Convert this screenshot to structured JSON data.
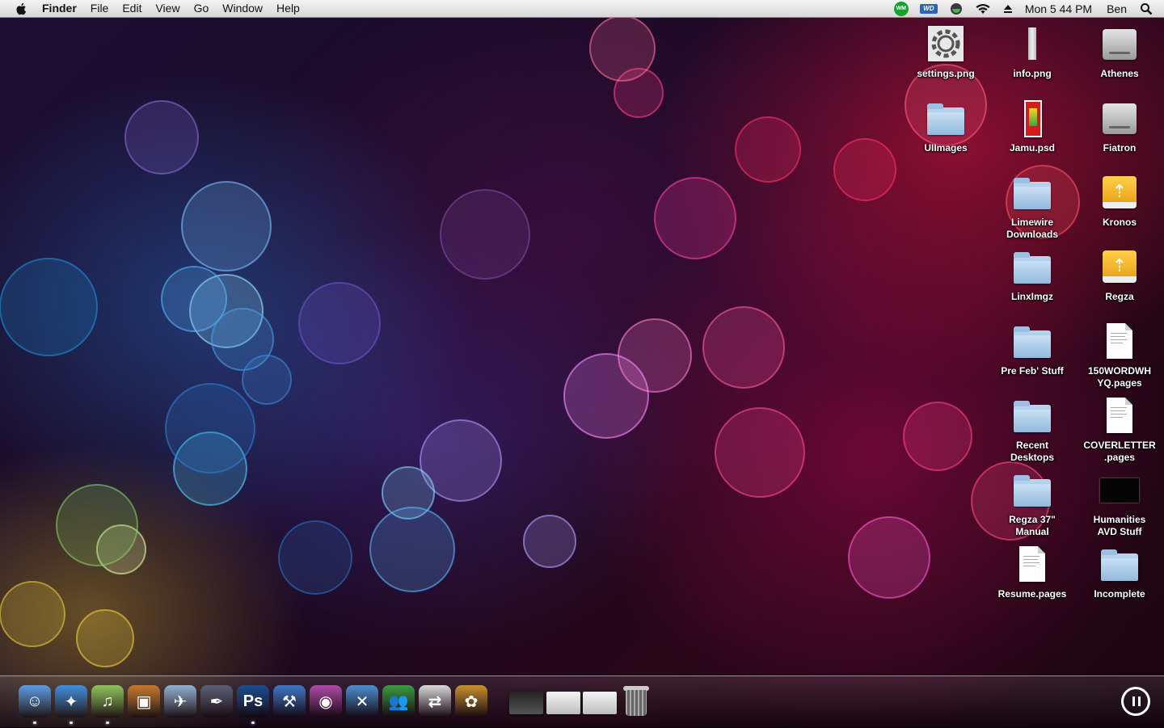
{
  "menubar": {
    "app_name": "Finder",
    "menus": [
      "File",
      "Edit",
      "View",
      "Go",
      "Window",
      "Help"
    ],
    "status_icons": {
      "wm_badge": "WM",
      "wd_badge": "WD"
    },
    "clock": "Mon 5 44 PM",
    "user": "Ben"
  },
  "desktop_icons": [
    {
      "label": "settings.png",
      "icon": "gear-image"
    },
    {
      "label": "info.png",
      "icon": "info-image"
    },
    {
      "label": "Athenes",
      "icon": "hard-drive"
    },
    {
      "label": "UIImages",
      "icon": "folder"
    },
    {
      "label": "Jamu.psd",
      "icon": "psd-file"
    },
    {
      "label": "Fiatron",
      "icon": "hard-drive"
    },
    {
      "label": "Limewire\nDownloads",
      "icon": "folder"
    },
    {
      "label": "Kronos",
      "icon": "usb-drive"
    },
    {
      "label": "LinxImgz",
      "icon": "folder"
    },
    {
      "label": "Regza",
      "icon": "usb-drive"
    },
    {
      "label": "Pre Feb' Stuff",
      "icon": "folder"
    },
    {
      "label": "150WORDWH\nYQ.pages",
      "icon": "document"
    },
    {
      "label": "Recent\nDesktops",
      "icon": "folder"
    },
    {
      "label": "COVERLETTER\n.pages",
      "icon": "document"
    },
    {
      "label": "Regza 37\"\nManual",
      "icon": "folder"
    },
    {
      "label": "Humanities\nAVD Stuff",
      "icon": "black-image"
    },
    {
      "label": "Resume.pages",
      "icon": "document"
    },
    {
      "label": "Incomplete",
      "icon": "folder"
    }
  ],
  "dock": {
    "apps": [
      {
        "name": "Finder",
        "icon": "finder-icon",
        "color": "#5b9be6",
        "glyph": "☺",
        "running": true
      },
      {
        "name": "Safari",
        "icon": "safari-icon",
        "color": "#3f8ee0",
        "glyph": "✦",
        "running": true
      },
      {
        "name": "iTunes",
        "icon": "itunes-icon",
        "color": "#8fc45a",
        "glyph": "♫",
        "running": true
      },
      {
        "name": "iPhoto",
        "icon": "iphoto-icon",
        "color": "#c9772b",
        "glyph": "▣",
        "running": false
      },
      {
        "name": "Preview",
        "icon": "preview-icon",
        "color": "#8fb0d6",
        "glyph": "✈",
        "running": false
      },
      {
        "name": "Pen Tool",
        "icon": "pen-tool-icon",
        "color": "#5a5f78",
        "glyph": "✒",
        "running": false
      },
      {
        "name": "Photoshop",
        "icon": "photoshop-icon",
        "color": "#1b4d8f",
        "glyph": "Ps",
        "running": true
      },
      {
        "name": "Xcode",
        "icon": "xcode-icon",
        "color": "#3d78c8",
        "glyph": "⚒",
        "running": false
      },
      {
        "name": "Growl",
        "icon": "growl-icon",
        "color": "#b04aa8",
        "glyph": "◉",
        "running": false
      },
      {
        "name": "Utilities",
        "icon": "utilities-icon",
        "color": "#4a8fd0",
        "glyph": "✕",
        "running": false
      },
      {
        "name": "Messenger",
        "icon": "messenger-icon",
        "color": "#3a9c3e",
        "glyph": "👥",
        "running": false
      },
      {
        "name": "Sync",
        "icon": "sync-icon",
        "color": "#d8d8d8",
        "glyph": "⇄",
        "running": false
      },
      {
        "name": "Adium",
        "icon": "adium-icon",
        "color": "#c8902a",
        "glyph": "✿",
        "running": false
      }
    ],
    "stacks": [
      {
        "name": "stack-1",
        "icon": "screenshot-stack-icon"
      },
      {
        "name": "stack-2",
        "icon": "window-stack-icon"
      },
      {
        "name": "stack-3",
        "icon": "document-stack-icon"
      }
    ],
    "trash": {
      "icon": "trash-icon"
    },
    "right_control": {
      "icon": "pause-icon"
    }
  }
}
